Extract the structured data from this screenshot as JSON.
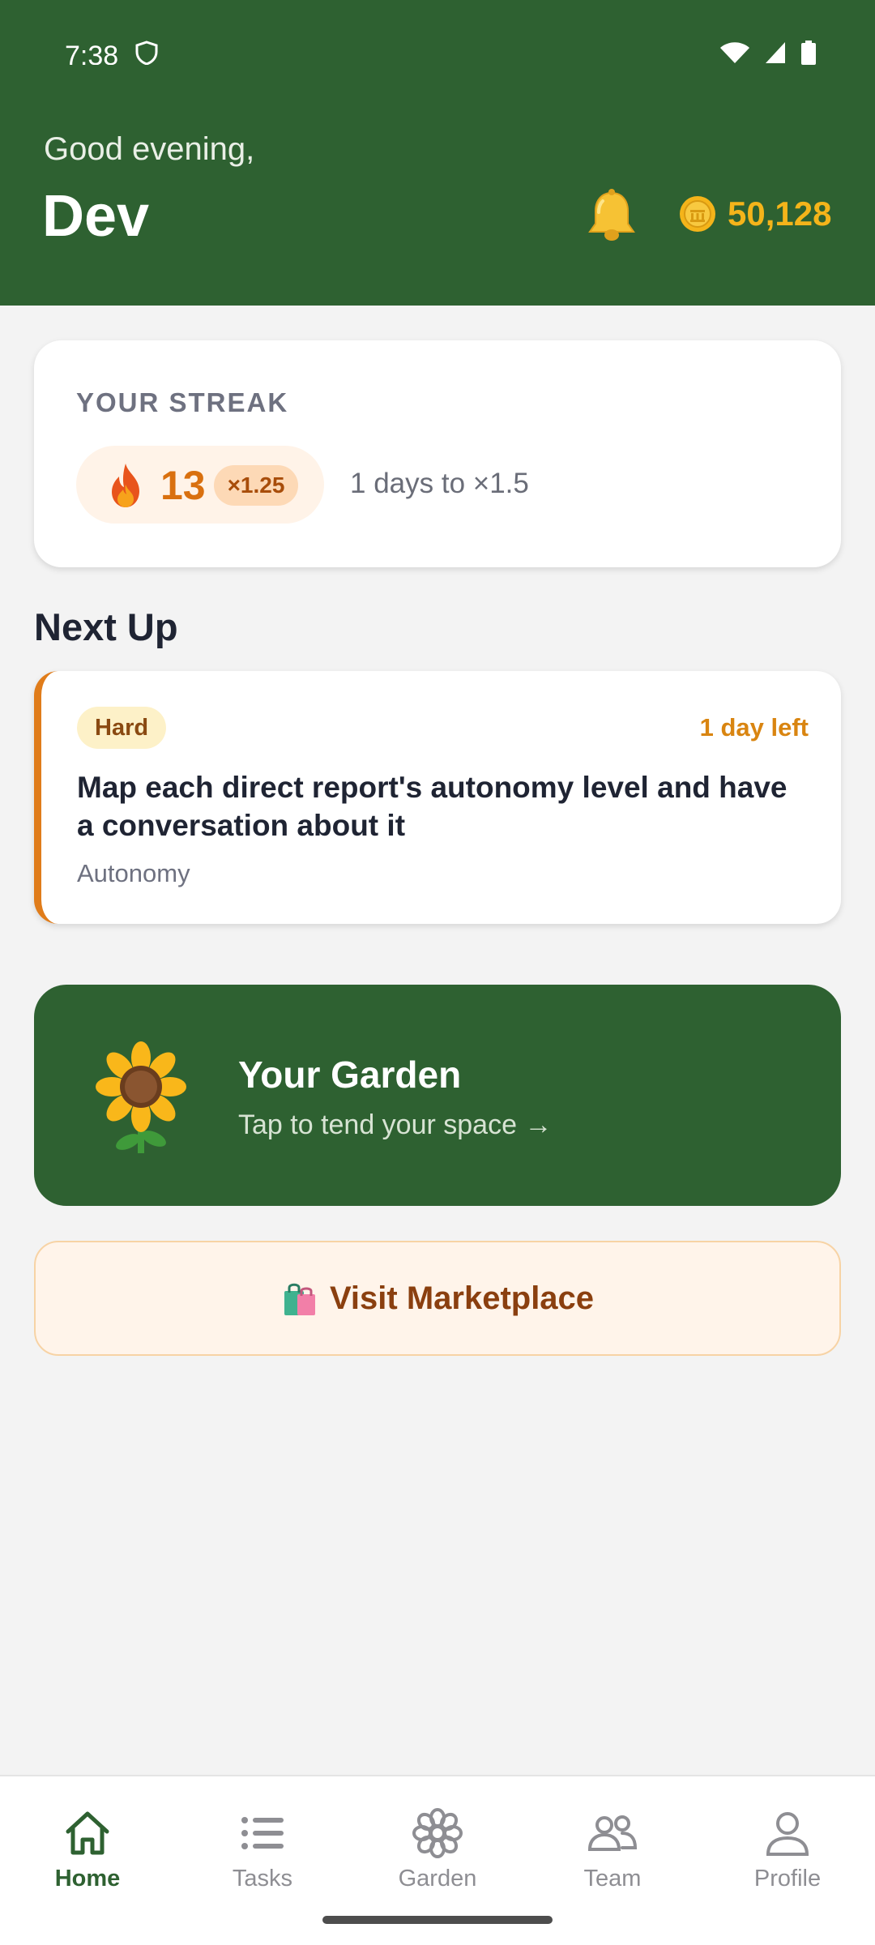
{
  "status_bar": {
    "time": "7:38"
  },
  "header": {
    "greeting": "Good evening,",
    "name": "Dev",
    "coins": "50,128",
    "bell_icon": "bell-icon",
    "coin_icon": "coin-icon"
  },
  "streak": {
    "title": "YOUR STREAK",
    "count": "13",
    "multiplier": "×1.25",
    "next": "1 days to ×1.5"
  },
  "next_up": {
    "title": "Next Up",
    "task": {
      "difficulty": "Hard",
      "deadline": "1 day left",
      "title": "Map each direct report's autonomy level and have a conversation about it",
      "category": "Autonomy"
    }
  },
  "garden": {
    "title": "Your Garden",
    "subtitle": "Tap to tend your space →"
  },
  "marketplace": {
    "label": "Visit Marketplace"
  },
  "nav": {
    "items": [
      {
        "label": "Home",
        "icon": "home-icon",
        "active": true
      },
      {
        "label": "Tasks",
        "icon": "list-icon",
        "active": false
      },
      {
        "label": "Garden",
        "icon": "flower-icon",
        "active": false
      },
      {
        "label": "Team",
        "icon": "team-icon",
        "active": false
      },
      {
        "label": "Profile",
        "icon": "profile-icon",
        "active": false
      }
    ]
  },
  "colors": {
    "brand_green": "#2e6131",
    "accent_orange": "#e07c1a",
    "coin_gold": "#f4b41a"
  }
}
